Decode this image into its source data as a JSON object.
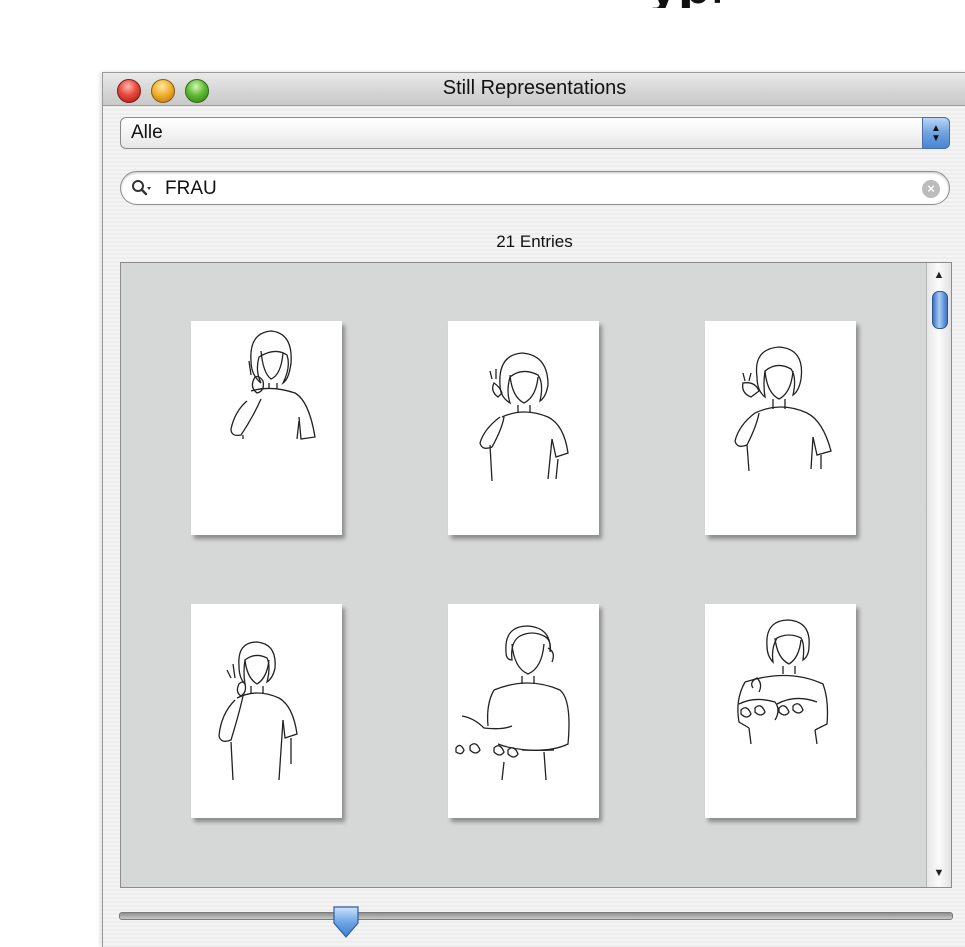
{
  "window": {
    "title": "Still Representations"
  },
  "filter_popup": {
    "selected": "Alle"
  },
  "search": {
    "value": "FRAU"
  },
  "status": {
    "entries": "21 Entries"
  },
  "gallery": {
    "items": [
      {
        "pose": "index-finger-on-cheek"
      },
      {
        "pose": "hand-at-ear"
      },
      {
        "pose": "pinch-at-cheek"
      },
      {
        "pose": "index-at-mouth"
      },
      {
        "pose": "two-handed-with-signs"
      },
      {
        "pose": "two-hands-in-front"
      }
    ]
  },
  "slider": {
    "value": 0.28
  },
  "scroll": {
    "position": 0.0
  },
  "colors": {
    "accent": "#4a84d2",
    "gallery_bg": "#d6d7d7"
  }
}
